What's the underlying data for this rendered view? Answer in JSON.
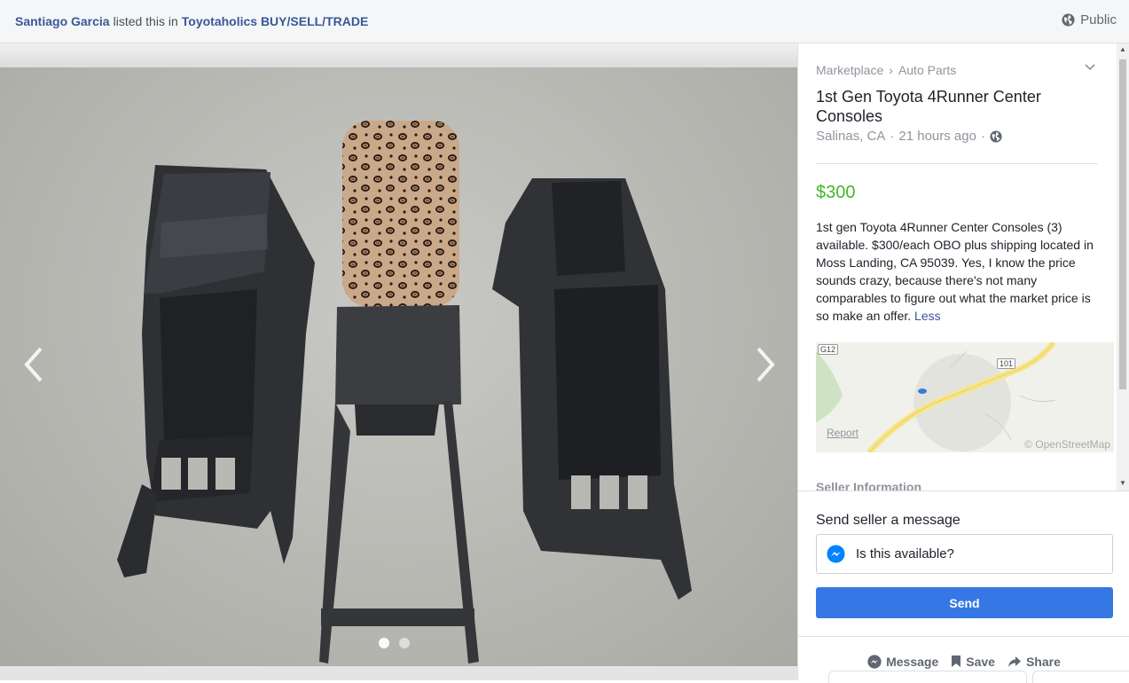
{
  "header": {
    "seller_name": "Santiago Garcia",
    "listed_text": "listed this in",
    "group_name": "Toyotaholics BUY/SELL/TRADE",
    "privacy_label": "Public"
  },
  "gallery": {
    "image_count": 2,
    "active_index": 0,
    "prev_icon": "chevron-left-icon",
    "next_icon": "chevron-right-icon"
  },
  "listing": {
    "breadcrumb": [
      "Marketplace",
      "Auto Parts"
    ],
    "breadcrumb_sep": "›",
    "title": "1st Gen Toyota 4Runner Center Consoles",
    "location": "Salinas, CA",
    "time_ago": "21 hours ago",
    "meta_sep": "·",
    "price": "$300",
    "description": "1st gen Toyota 4Runner Center Consoles (3) available.  $300/each OBO plus shipping located in Moss Landing, CA 95039.  Yes, I know the price sounds crazy, because there's not many comparables to figure out what the market price is so make an offer.",
    "less_label": "Less"
  },
  "map": {
    "report_label": "Report",
    "attribution": "© OpenStreetMap",
    "route_badge_1": "G12",
    "route_badge_2": "101"
  },
  "seller_section": {
    "heading": "Seller Information"
  },
  "message": {
    "label": "Send seller a message",
    "input_value": "Is this available?",
    "send_label": "Send"
  },
  "actions": {
    "message_label": "Message",
    "save_label": "Save",
    "share_label": "Share"
  },
  "colors": {
    "link": "#385898",
    "price": "#42b72a",
    "primary_button": "#3578e5",
    "messenger": "#0084ff"
  }
}
